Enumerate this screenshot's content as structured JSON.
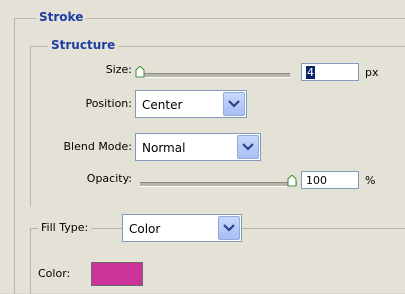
{
  "stroke_group": {
    "title": "Stroke"
  },
  "structure_group": {
    "title": "Structure",
    "size": {
      "label": "Size:",
      "value": "4",
      "unit": "px",
      "slider_level": 0.03
    },
    "position": {
      "label": "Position:",
      "value": "Center"
    },
    "blend_mode": {
      "label": "Blend Mode:",
      "value": "Normal"
    },
    "opacity": {
      "label": "Opacity:",
      "value": "100",
      "unit": "%",
      "slider_level": 1.0
    }
  },
  "fill_group": {
    "fill_type": {
      "label": "Fill Type:",
      "value": "Color"
    },
    "color": {
      "label": "Color:",
      "swatch": "#cc3399"
    }
  },
  "colors": {
    "title_blue": "#1f3fa3",
    "panel": "#e4e1d7",
    "swatch": "#cc3399"
  },
  "icons": {
    "dropdown_arrow": "chevron-down-icon",
    "slider_thumb": "slider-thumb-icon"
  }
}
